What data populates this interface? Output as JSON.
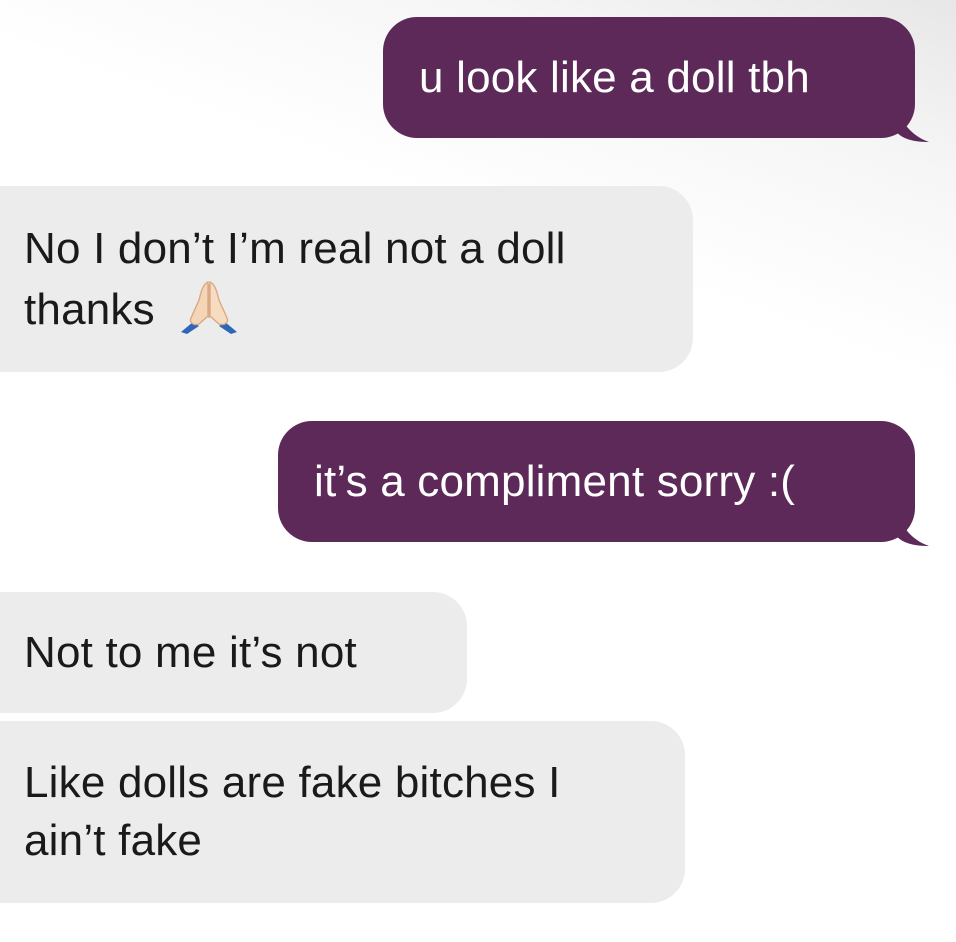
{
  "conversation": {
    "messages": [
      {
        "direction": "sent",
        "text": "u look like a doll tbh"
      },
      {
        "direction": "received",
        "text": "No I don’t I’m real not a doll thanks",
        "emoji": "folded-hands-icon"
      },
      {
        "direction": "sent",
        "text": "it’s a compliment sorry :("
      },
      {
        "direction": "received",
        "text": "Not to me it’s not"
      },
      {
        "direction": "received",
        "text": "Like dolls are fake bitches I ain’t fake"
      }
    ]
  },
  "colors": {
    "sent_bubble": "#5d2959",
    "received_bubble": "#ececec",
    "sent_text": "#ffffff",
    "received_text": "#1a1a1a"
  }
}
